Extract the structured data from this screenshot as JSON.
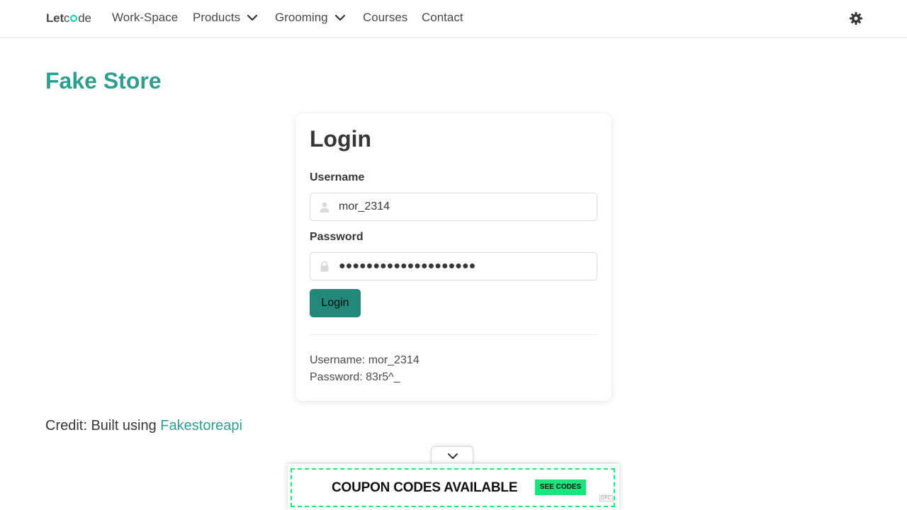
{
  "nav": {
    "brand_let": "Let",
    "brand_c": "c",
    "brand_de": "de",
    "items": [
      {
        "label": "Work-Space"
      },
      {
        "label": "Products"
      },
      {
        "label": "Grooming"
      },
      {
        "label": "Courses"
      },
      {
        "label": "Contact"
      }
    ],
    "theme_icon": "gear-icon"
  },
  "page": {
    "title": "Fake Store"
  },
  "login": {
    "title": "Login",
    "username_label": "Username",
    "username_value": "mor_2314",
    "password_label": "Password",
    "password_value": "●●●●●●●●●●●●●●●●●●●●",
    "button_label": "Login",
    "hint_username": "Username: mor_2314",
    "hint_password": "Password: 83r5^_"
  },
  "credit": {
    "text": "Credit: Built using ",
    "link": "Fakestoreapi"
  },
  "ad": {
    "headline": "COUPON CODES AVAILABLE",
    "cta": "SEE CODES",
    "badge": "GFC"
  },
  "colors": {
    "accent": "#2f9e8f",
    "button": "#22897a",
    "ad_green": "#18e67a"
  }
}
